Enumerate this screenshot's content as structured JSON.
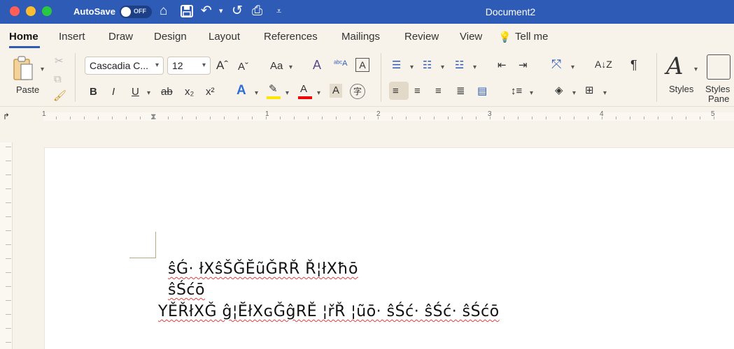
{
  "titlebar": {
    "autosave_label": "AutoSave",
    "autosave_state": "OFF",
    "document_title": "Document2"
  },
  "tabs": [
    "Home",
    "Insert",
    "Draw",
    "Design",
    "Layout",
    "References",
    "Mailings",
    "Review",
    "View",
    "Tell me"
  ],
  "ribbon": {
    "paste_label": "Paste",
    "font_name": "Cascadia C...",
    "font_size": "12",
    "grow_font": "Aˆ",
    "shrink_font": "Aˇ",
    "change_case": "Aa",
    "bold": "B",
    "italic": "I",
    "underline": "U",
    "strikethrough": "ab",
    "subscript": "x₂",
    "superscript": "x²",
    "text_effects": "A",
    "highlight": "✎",
    "font_color": "A",
    "char_shading": "A",
    "phonetic": "字",
    "styles_label": "Styles",
    "styles_pane_label_1": "Styles",
    "styles_pane_label_2": "Pane",
    "pilcrow": "¶"
  },
  "ruler": {
    "numbers": [
      "1",
      "1",
      "2",
      "3",
      "4",
      "5"
    ]
  },
  "document": {
    "lines": [
      "ŝǴ· łXŝŠǦĔũǦRŘ Ř¦łXħō",
      "ŝŚćō",
      "YĚŘłXǦ ĝ¦ĔłXɢǦĝRĚ ¦řŘ ¦ũō· ŝŚć· ŝŚć· ŝŚćō"
    ]
  },
  "colors": {
    "titlebar": "#2d5bb5",
    "canvas": "#f7f3ea",
    "highlight": "#ffe600",
    "font_color_bar": "#e00000",
    "spellcheck": "#e04040"
  }
}
